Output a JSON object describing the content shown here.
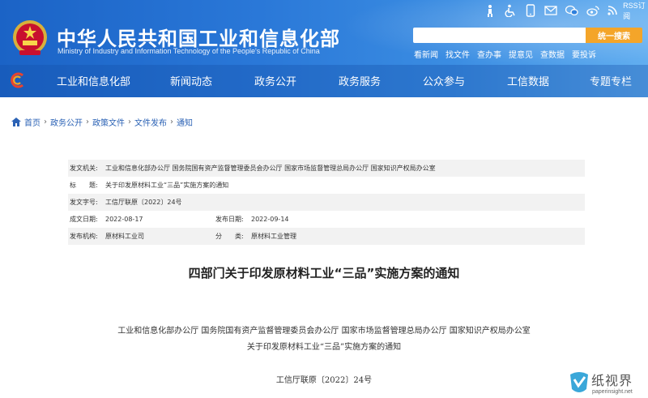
{
  "header": {
    "title": "中华人民共和国工业和信息化部",
    "subtitle": "Ministry of Industry and Information Technology of the People's Republic of China",
    "rss_label": "RSS订阅",
    "search_placeholder": "",
    "search_button": "统一搜索",
    "quick_links": [
      "看新闻",
      "找文件",
      "查办事",
      "提意见",
      "查数据",
      "要投诉"
    ],
    "nav_items": [
      "工业和信息化部",
      "新闻动态",
      "政务公开",
      "政务服务",
      "公众参与",
      "工信数据",
      "专题专栏"
    ],
    "colors": {
      "primary": "#1b63c6",
      "search_button": "#f4a529"
    }
  },
  "breadcrumb": [
    "首页",
    "政务公开",
    "政策文件",
    "文件发布",
    "通知"
  ],
  "meta": {
    "issuer_label": "发文机关:",
    "issuer_value": "工业和信息化部办公厅 国务院国有资产监督管理委员会办公厅 国家市场监督管理总局办公厅 国家知识产权局办公室",
    "title_label": "标　　题:",
    "title_value": "关于印发原材料工业“三品”实施方案的通知",
    "doc_no_label": "发文字号:",
    "doc_no_value": "工信厅联原〔2022〕24号",
    "created_label": "成文日期:",
    "created_value": "2022-08-17",
    "published_label": "发布日期:",
    "published_value": "2022-09-14",
    "org_label": "发布机构:",
    "org_value": "原材料工业司",
    "category_label": "分　　类:",
    "category_value": "原材料工业管理"
  },
  "article": {
    "title": "四部门关于印发原材料工业“三品”实施方案的通知",
    "line1": "工业和信息化部办公厅 国务院国有资产监督管理委员会办公厅 国家市场监督管理总局办公厅 国家知识产权局办公室",
    "line2": "关于印发原材料工业“三品”实施方案的通知",
    "doc_no": "工信厅联原〔2022〕24号"
  },
  "watermark": {
    "text": "纸视界",
    "url": "paperinsight.net"
  }
}
